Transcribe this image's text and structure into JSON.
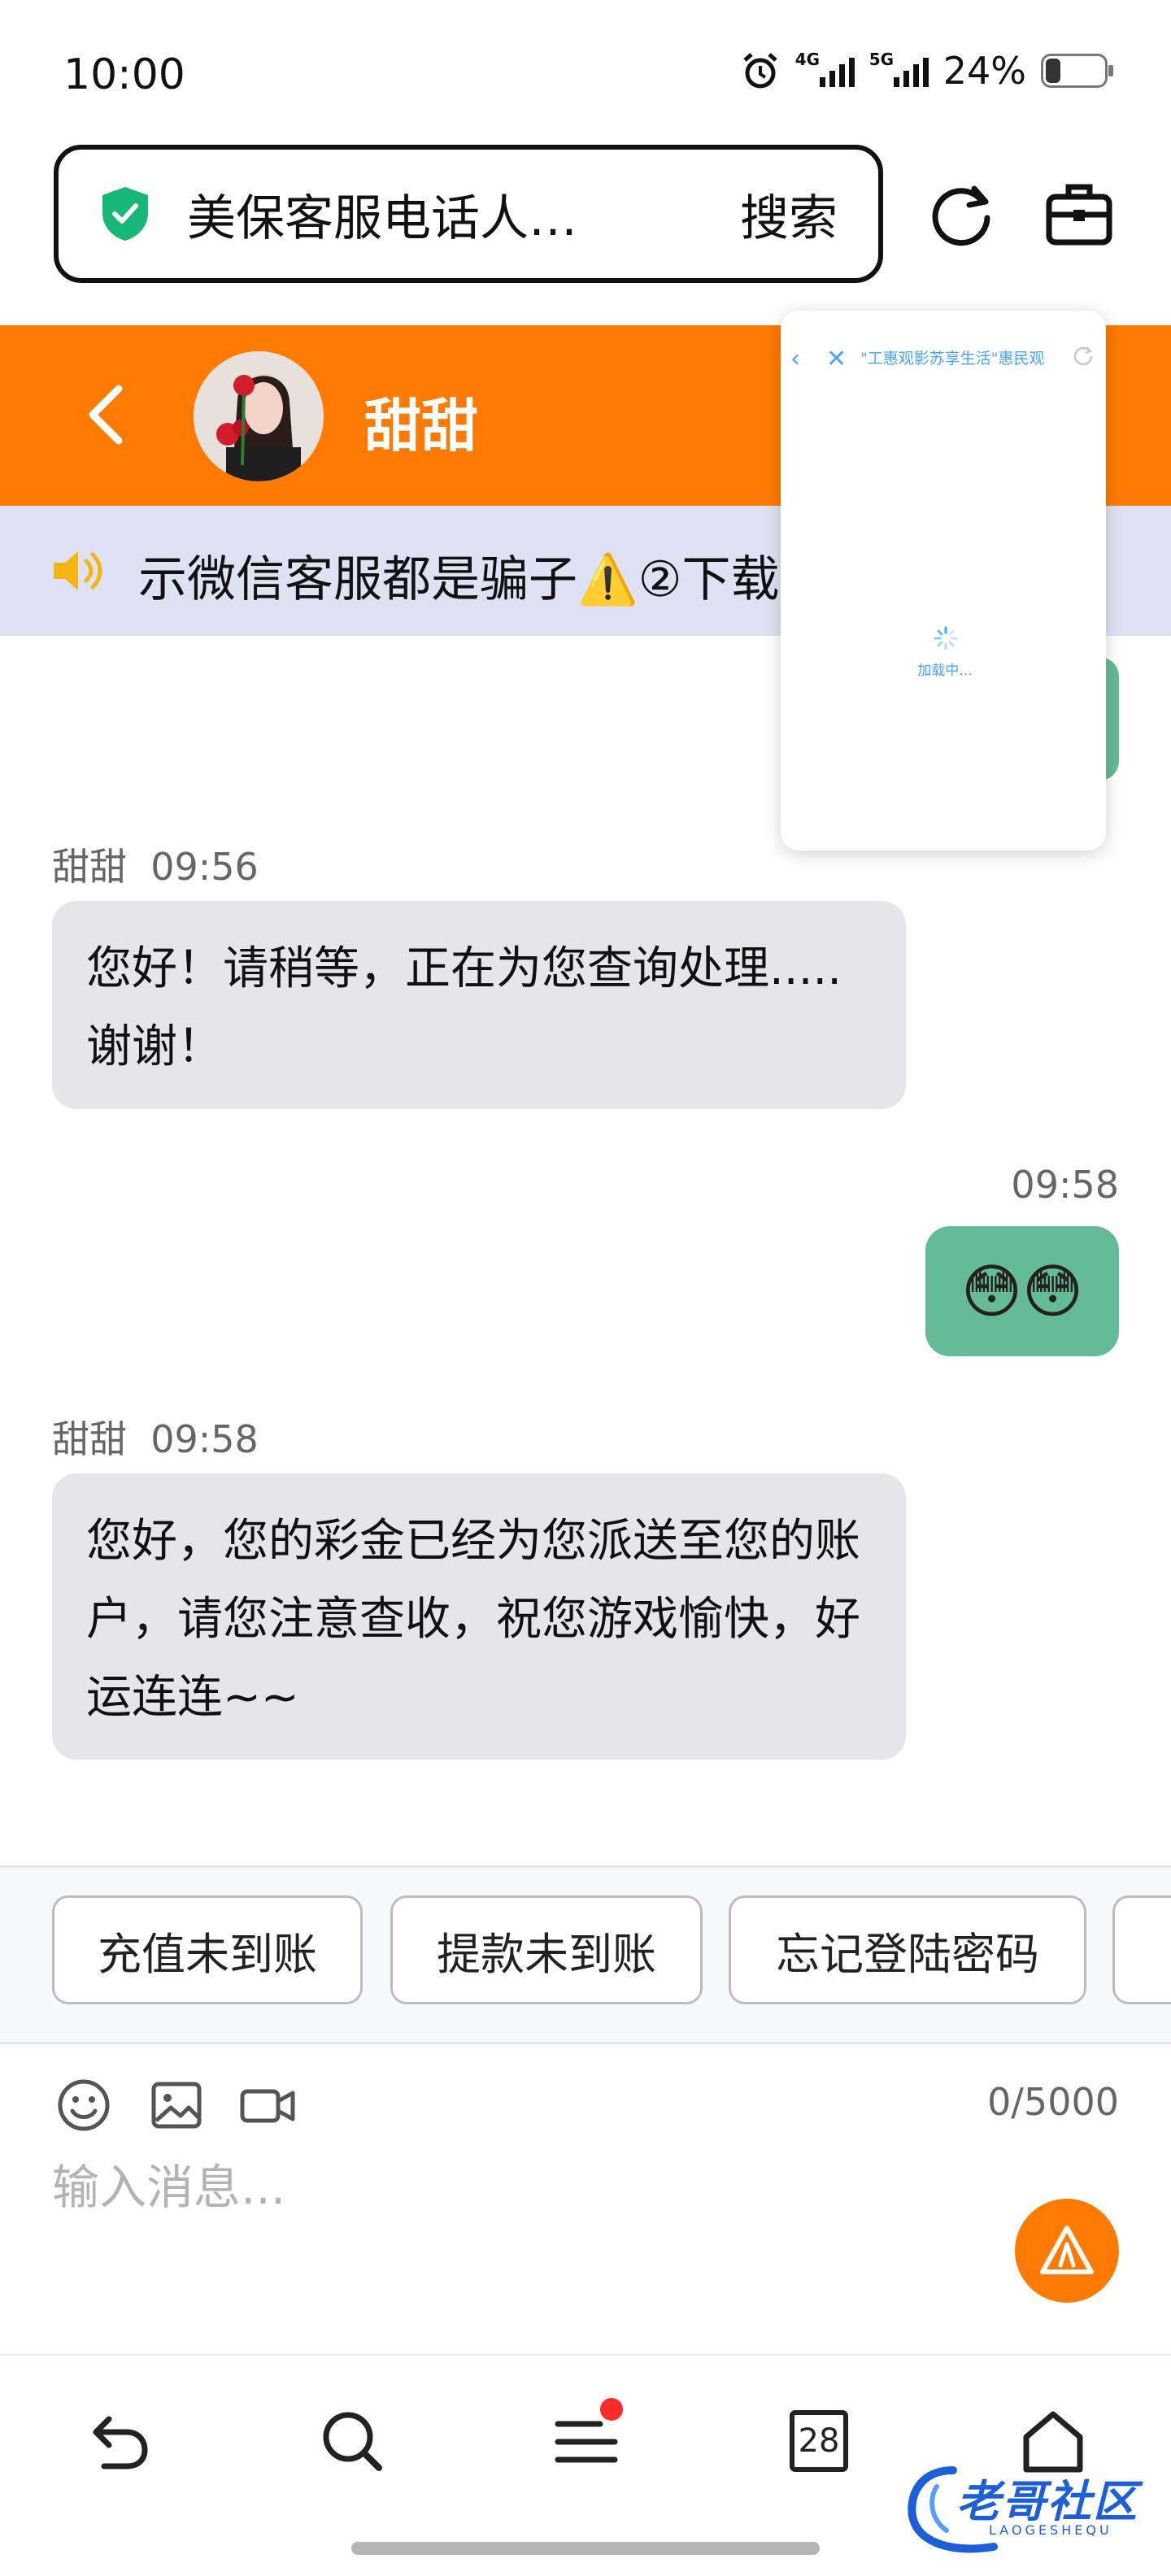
{
  "status_bar": {
    "time": "10:00",
    "net1": "4G",
    "net2": "5G",
    "battery": "24%",
    "battery_level": 0.24
  },
  "browser": {
    "url_title": "美保客服电话人…",
    "search_label": "搜索"
  },
  "chat": {
    "contact_name": "甜甜",
    "notice": "示微信客服都是骗子⚠️②下载",
    "messages": [
      {
        "sender": "甜甜",
        "time": "09:56",
        "text": "您好！请稍等，正在为您查询处理.....谢谢！"
      },
      {
        "time": "09:58",
        "text": "😳😳"
      },
      {
        "sender": "甜甜",
        "time": "09:58",
        "text": "您好，您的彩金已经为您派送至您的账户，请您注意查收，祝您游戏愉快，好运连连~~"
      }
    ]
  },
  "popup": {
    "title": "\"工惠观影苏享生活\"惠民观",
    "loading": "加载中..."
  },
  "quick_replies": [
    "充值未到账",
    "提款未到账",
    "忘记登陆密码"
  ],
  "input": {
    "placeholder": "输入消息...",
    "counter": "0/5000"
  },
  "bottom_nav": {
    "calendar_day": "28"
  },
  "watermark": {
    "text": "老哥社区",
    "sub": "LAOGESHEQU"
  },
  "colors": {
    "accent": "#ff7a00",
    "outgoing_bubble": "#66bb97",
    "incoming_bubble": "#e6e6ea",
    "notice_bg": "#dfe2f3"
  },
  "icons": [
    "shield-check-icon",
    "refresh-icon",
    "toolbox-icon",
    "back-arrow-icon",
    "speaker-icon",
    "emoji-icon",
    "image-icon",
    "video-icon",
    "warning-send-icon",
    "undo-icon",
    "search-icon",
    "menu-icon",
    "calendar-icon",
    "home-icon"
  ]
}
